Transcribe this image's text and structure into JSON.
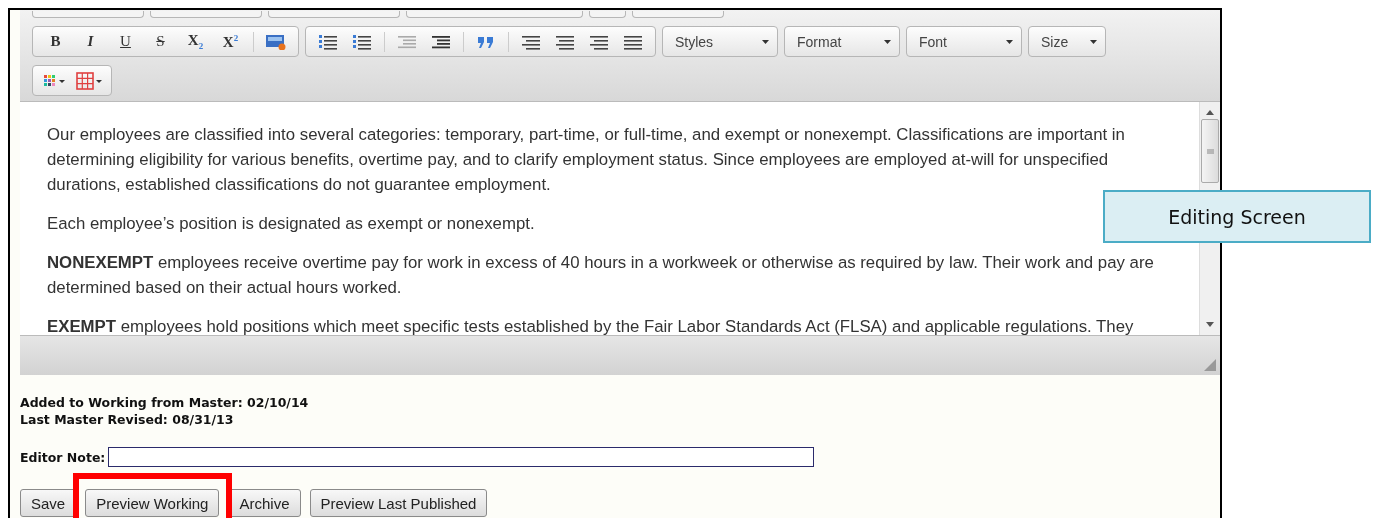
{
  "toolbar": {
    "format_buttons": [
      {
        "label": "B",
        "kind": "bold"
      },
      {
        "label": "I",
        "kind": "italic"
      },
      {
        "label": "U",
        "kind": "underline"
      },
      {
        "label": "S",
        "kind": "strike"
      },
      {
        "label": "X$_{2}$",
        "kind": "script"
      },
      {
        "label": "X$^{2}$",
        "kind": "script"
      }
    ],
    "dropdowns": [
      "Styles",
      "Format",
      "Font",
      "Size"
    ]
  },
  "content": {
    "paragraphs": [
      "Our employees are classified into several categories: temporary, part-time, or full-time, and exempt or nonexempt. Classifications are important in determining eligibility for various benefits, overtime pay, and to clarify employment status. Since employees are employed at-will for unspecified durations, established classifications do not guarantee employment.",
      "Each employee’s position is designated as exempt or nonexempt.",
      "**NONEXEMPT** employees receive overtime pay for work in excess of 40 hours in a workweek or otherwise as required by law. Their work and pay are determined based on their actual hours worked.",
      "**EXEMPT** employees hold positions which meet specific tests established by the Fair Labor Standards Act (FLSA) and applicable regulations. They"
    ]
  },
  "meta": [
    "Added to Working from Master: 02/10/14",
    "Last Master Revised: 08/31/13"
  ],
  "editor_note": {
    "label": "Editor Note:"
  },
  "buttons": [
    {
      "label": "Save",
      "highlighted": false
    },
    {
      "label": "Preview Working",
      "highlighted": true
    },
    {
      "label": "Archive",
      "highlighted": false
    },
    {
      "label": "Preview Last Published",
      "highlighted": false
    }
  ],
  "callout": "Editing Screen"
}
